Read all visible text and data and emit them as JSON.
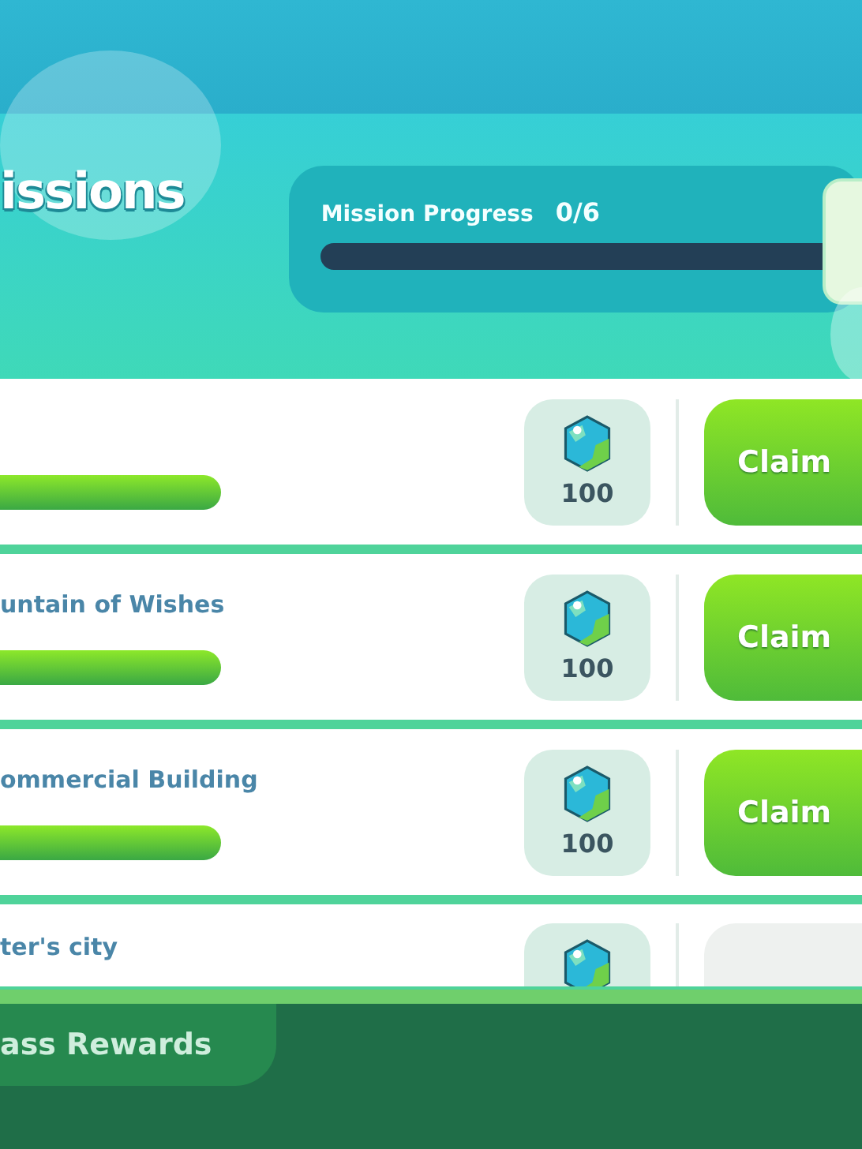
{
  "header": {
    "title": "issions",
    "progress": {
      "label": "Mission Progress",
      "count": "0/6",
      "level": 0
    }
  },
  "missions": [
    {
      "kind": "claim",
      "level": 1,
      "reward": "100",
      "button": "Claim"
    },
    {
      "kind": "claim",
      "title": "untain of Wishes",
      "level": 1,
      "reward": "100",
      "button": "Claim"
    },
    {
      "kind": "claim",
      "title": "ommercial Building",
      "level": 1,
      "reward": "100",
      "button": "Claim"
    },
    {
      "kind": "go",
      "title": "ter's city"
    }
  ],
  "bottom_tab": {
    "label": "ass Rewards"
  }
}
